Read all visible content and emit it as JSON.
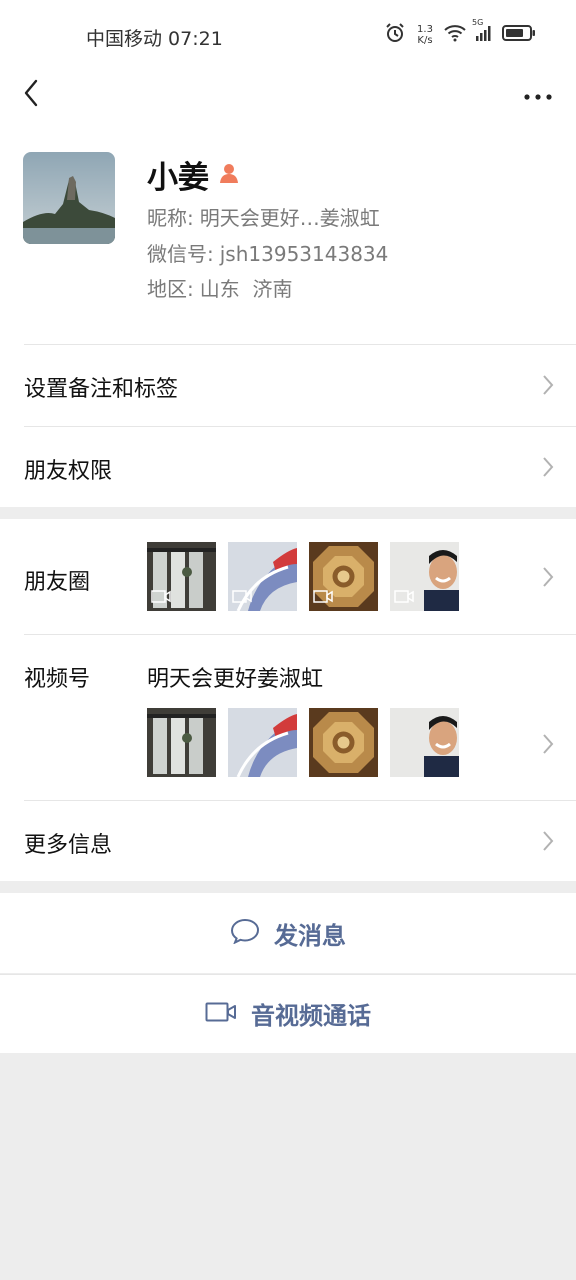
{
  "status_bar": {
    "carrier_time": "中国移动 07:21",
    "speed_value": "1.3",
    "speed_unit": "K/s",
    "network": "5G",
    "icons": [
      "alarm-icon",
      "wifi-icon",
      "cellular-signal-icon",
      "battery-icon"
    ]
  },
  "nav": {
    "back_icon": "chevron-left-icon",
    "more_icon": "more-dots-icon"
  },
  "profile": {
    "name": "小姜",
    "nickname_label": "昵称:",
    "nickname": "明天会更好…姜淑虹",
    "wechat_id_label": "微信号:",
    "wechat_id": "jsh13953143834",
    "region_label": "地区:",
    "region": "山东  济南"
  },
  "rows": {
    "remark_tags": "设置备注和标签",
    "friend_permissions": "朋友权限",
    "moments": "朋友圈",
    "channels_label": "视频号",
    "channels_name": "明天会更好姜淑虹",
    "more_info": "更多信息"
  },
  "actions": {
    "send_message": "发消息",
    "video_call": "音视频通话"
  },
  "colors": {
    "link_blue": "#576b95",
    "background_gray": "#ededed"
  }
}
